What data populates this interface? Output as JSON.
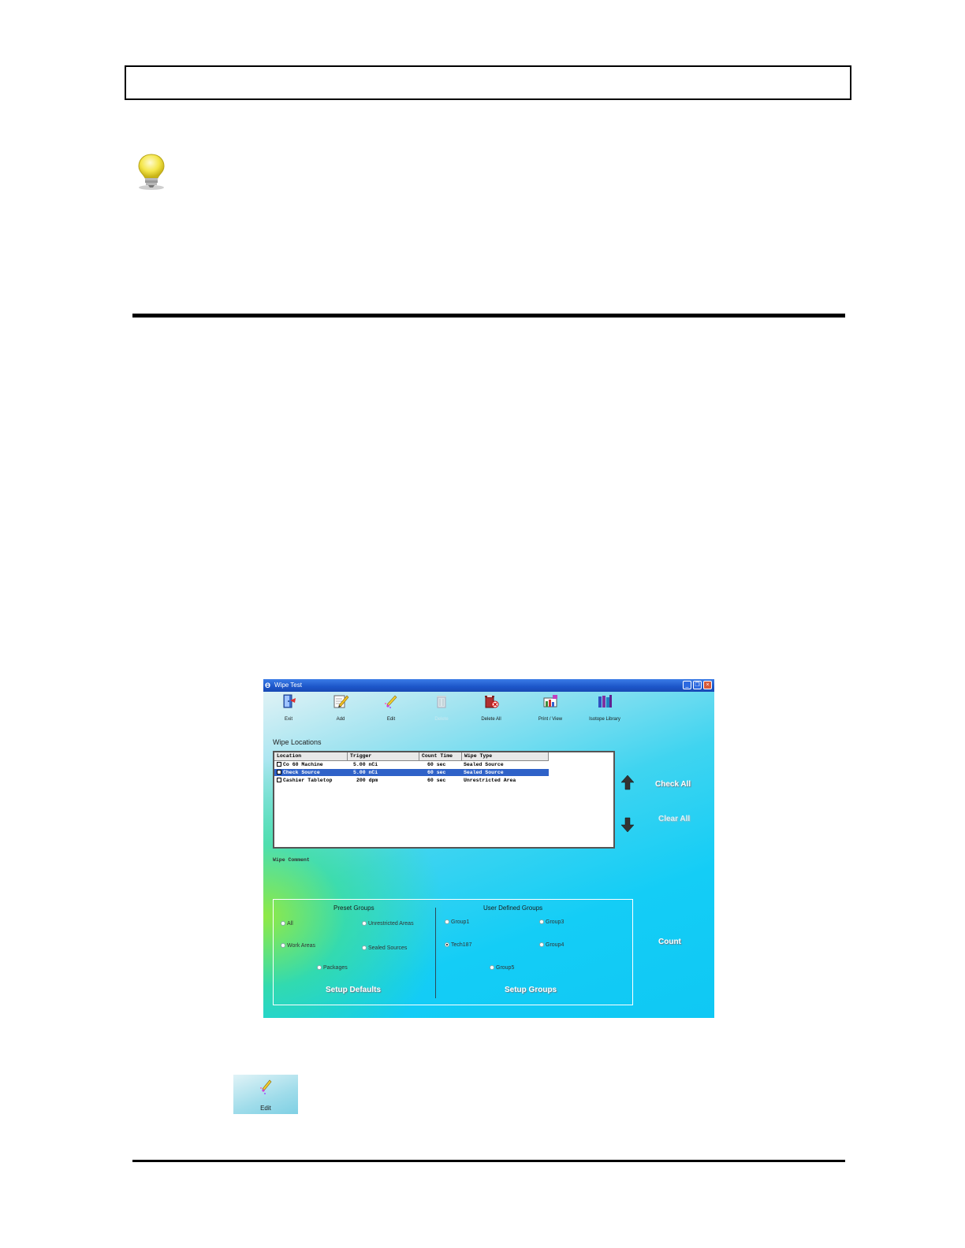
{
  "window": {
    "title": "Wipe Test",
    "app_icon": "ϴ",
    "controls": {
      "minimize": "_",
      "restore": "❐",
      "close": "×"
    }
  },
  "toolbar": [
    {
      "label": "Exit",
      "icon": "exit-door-icon",
      "enabled": true
    },
    {
      "label": "Add",
      "icon": "add-pencil-icon",
      "enabled": true
    },
    {
      "label": "Edit",
      "icon": "edit-wand-icon",
      "enabled": true
    },
    {
      "label": "Delete",
      "icon": "delete-bin-icon",
      "enabled": false
    },
    {
      "label": "Delete All",
      "icon": "delete-all-icon",
      "enabled": true
    },
    {
      "label": "Print / View",
      "icon": "print-view-icon",
      "enabled": true
    },
    {
      "label": "Isotope Library",
      "icon": "isotope-library-icon",
      "enabled": true
    }
  ],
  "wipe_locations": {
    "title": "Wipe Locations",
    "columns": [
      "Location",
      "Trigger",
      "Count Time",
      "Wipe Type"
    ],
    "rows": [
      {
        "location": "Co 60 Machine",
        "trigger": "5.00 nCi",
        "count_time": "60 sec",
        "wipe_type": "Sealed Source",
        "selected": false
      },
      {
        "location": "Check Source",
        "trigger": "5.00 nCi",
        "count_time": "60 sec",
        "wipe_type": "Sealed Source",
        "selected": true
      },
      {
        "location": "Cashier Tabletop",
        "trigger": "200 dpm",
        "count_time": "60 sec",
        "wipe_type": "Unrestricted Area",
        "selected": false
      }
    ]
  },
  "side_buttons": {
    "check_all": "Check All",
    "clear_all": "Clear All",
    "count": "Count"
  },
  "wipe_comment_label": "Wipe Comment",
  "preset_groups": {
    "title": "Preset Groups",
    "options": [
      "All",
      "Unrestricted Areas",
      "Work Areas",
      "Sealed Sources",
      "Packages"
    ],
    "button": "Setup Defaults"
  },
  "user_groups": {
    "title": "User Defined Groups",
    "options": [
      "Group1",
      "Group3",
      "Tech187",
      "Group4",
      "Group5"
    ],
    "selected": "Tech187",
    "button": "Setup Groups"
  },
  "edit_thumbnail": {
    "label": "Edit",
    "icon": "edit-wand-icon"
  },
  "colors": {
    "selection": "#2f62c8",
    "titlebar": "#1c56c9",
    "window_bg": "#14cdf6"
  }
}
